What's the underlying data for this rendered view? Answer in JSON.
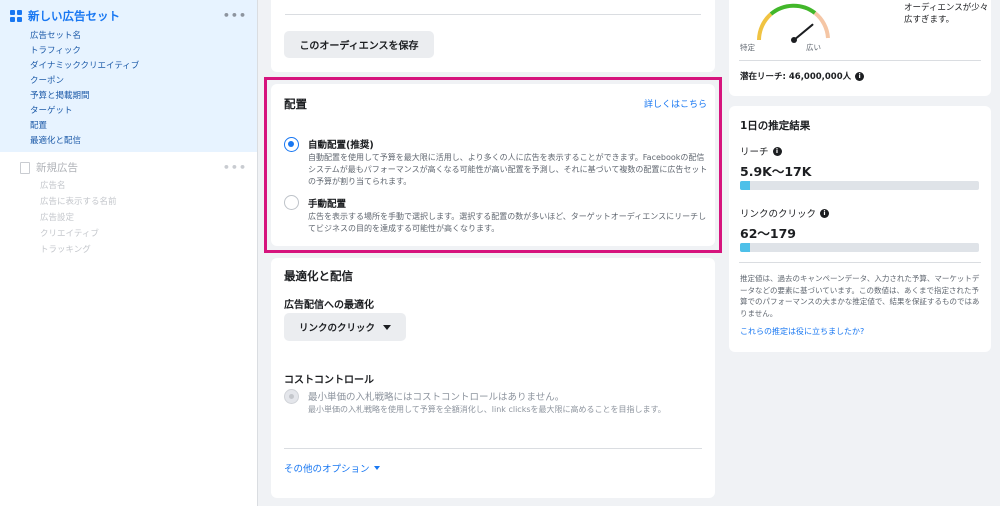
{
  "sidebar": {
    "active_set": {
      "title": "新しい広告セット",
      "items": [
        "広告セット名",
        "トラフィック",
        "ダイナミッククリエイティブ",
        "クーポン",
        "予算と掲載期間",
        "ターゲット",
        "配置",
        "最適化と配信"
      ]
    },
    "new_ad": {
      "title": "新規広告",
      "items": [
        "広告名",
        "広告に表示する名前",
        "広告設定",
        "クリエイティブ",
        "トラッキング"
      ]
    }
  },
  "audience": {
    "save_button": "このオーディエンスを保存"
  },
  "placement": {
    "title": "配置",
    "learn_more": "詳しくはこちら",
    "auto": {
      "title": "自動配置(推奨)",
      "desc": "自動配置を使用して予算を最大限に活用し、より多くの人に広告を表示することができます。Facebookの配信システムが最もパフォーマンスが高くなる可能性が高い配置を予測し、それに基づいて複数の配置に広告セットの予算が割り当てられます。",
      "selected": true
    },
    "manual": {
      "title": "手動配置",
      "desc": "広告を表示する場所を手動で選択します。選択する配置の数が多いほど、ターゲットオーディエンスにリーチしてビジネスの目的を達成する可能性が高くなります。",
      "selected": false
    }
  },
  "optimization": {
    "title": "最適化と配信",
    "goal_label": "広告配信への最適化",
    "goal_value": "リンクのクリック",
    "cost_title": "コストコントロール",
    "cost_main": "最小単価の入札戦略にはコストコントロールはありません。",
    "cost_sub": "最小単価の入札戦略を使用して予算を全額消化し、link clicksを最大限に高めることを目指します。",
    "more_options": "その他のオプション"
  },
  "audience_size": {
    "specific": "特定",
    "broad": "広い",
    "status": "オーディエンスが少々広すぎます。",
    "potential_reach": "潜在リーチ: 46,000,000人",
    "gauge_level": 0.78
  },
  "estimates": {
    "title": "1日の推定結果",
    "reach_label": "リーチ",
    "reach_value": "5.9K〜17K",
    "reach_fill": 0.04,
    "clicks_label": "リンクのクリック",
    "clicks_value": "62〜179",
    "clicks_fill": 0.04,
    "note": "推定値は、過去のキャンペーンデータ、入力された予算、マーケットデータなどの要素に基づいています。この数値は、あくまで指定された予算でのパフォーマンスの大まかな推定値で、結果を保証するものではありません。",
    "feedback_link": "これらの推定は役に立ちましたか?"
  },
  "colors": {
    "accent": "#1877f2",
    "highlight": "#d6147d",
    "bar_fill": "#4ec0e9"
  }
}
